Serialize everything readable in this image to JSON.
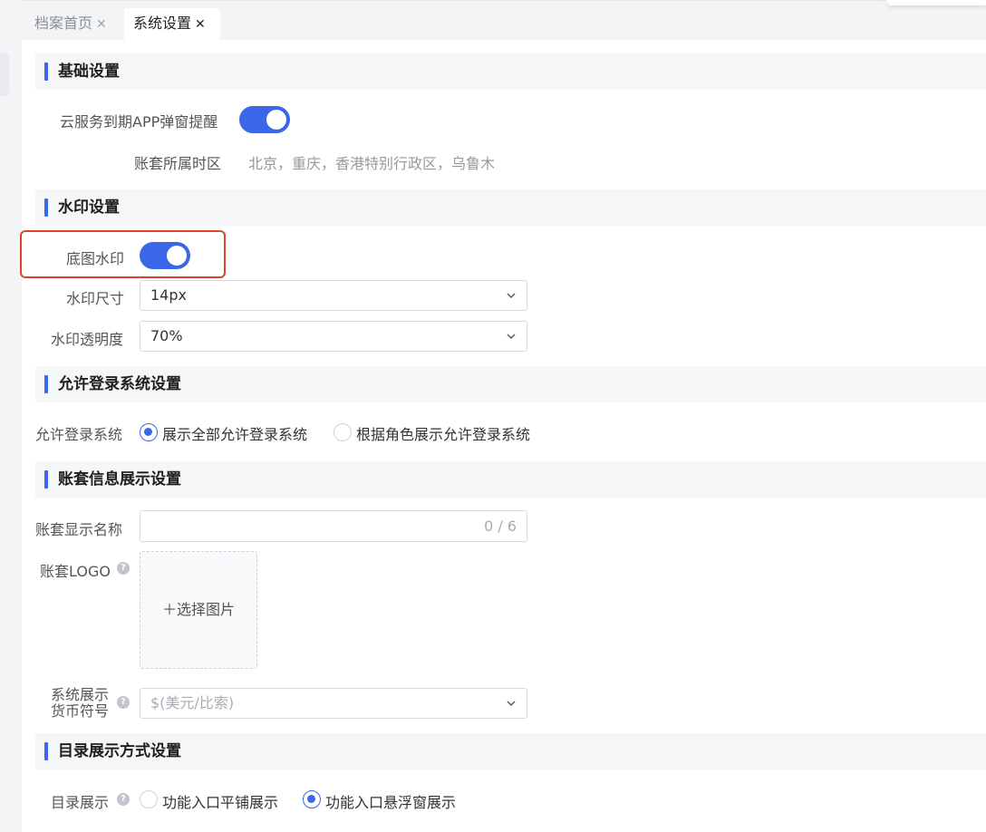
{
  "tabs": [
    {
      "label": "档案首页",
      "close": "✕",
      "active": false
    },
    {
      "label": "系统设置",
      "close": "✕",
      "active": true
    }
  ],
  "sections": {
    "basic": {
      "title": "基础设置"
    },
    "watermark": {
      "title": "水印设置"
    },
    "login": {
      "title": "允许登录系统设置"
    },
    "account_display": {
      "title": "账套信息展示设置"
    },
    "directory": {
      "title": "目录展示方式设置"
    }
  },
  "basic": {
    "cloud_popup_label": "云服务到期APP弹窗提醒",
    "cloud_popup_on": true,
    "timezone_label": "账套所属时区",
    "timezone_value": "北京，重庆，香港特别行政区，乌鲁木"
  },
  "watermark": {
    "bg_label": "底图水印",
    "bg_on": true,
    "size_label": "水印尺寸",
    "size_value": "14px",
    "opacity_label": "水印透明度",
    "opacity_value": "70%"
  },
  "login": {
    "label": "允许登录系统",
    "options": [
      "展示全部允许登录系统",
      "根据角色展示允许登录系统"
    ],
    "selected_index": 0
  },
  "account_display": {
    "name_label": "账套显示名称",
    "name_value": "",
    "name_counter": "0 / 6",
    "logo_label": "账套LOGO",
    "logo_upload": "＋选择图片",
    "currency_label_line1": "系统展示",
    "currency_label_line2": "货币符号",
    "currency_value": "$(美元/比索)"
  },
  "directory": {
    "label": "目录展示",
    "options": [
      "功能入口平铺展示",
      "功能入口悬浮窗展示"
    ],
    "selected_index": 1
  },
  "icons": {
    "help": "?",
    "chevron": "chevron-down-icon"
  },
  "colors": {
    "accent": "#3a67e8",
    "highlight_border": "#d9452c",
    "section_bg": "#f5f6f8"
  }
}
